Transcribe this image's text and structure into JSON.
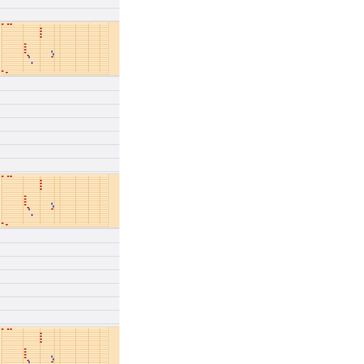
{
  "app": {
    "title": ""
  },
  "list": {
    "items": [
      {
        "type": "blank"
      },
      {
        "type": "thumbnail",
        "thumb": "spreadsheet-thumbnail"
      },
      {
        "type": "blank"
      },
      {
        "type": "blank"
      },
      {
        "type": "blank"
      },
      {
        "type": "blank"
      },
      {
        "type": "blank"
      },
      {
        "type": "blank"
      },
      {
        "type": "blank"
      },
      {
        "type": "thumbnail",
        "thumb": "spreadsheet-thumbnail"
      },
      {
        "type": "blank"
      },
      {
        "type": "blank"
      },
      {
        "type": "blank"
      },
      {
        "type": "blank"
      },
      {
        "type": "blank"
      },
      {
        "type": "blank"
      },
      {
        "type": "blank"
      },
      {
        "type": "thumbnail",
        "thumb": "spreadsheet-thumbnail"
      }
    ]
  },
  "colors": {
    "list_background": "#f1f1f4",
    "row_divider": "#d8d8dd",
    "thumbnail_fill": "#fde7c2",
    "thumbnail_accent_red": "#c23a2a",
    "thumbnail_accent_blue": "#4a57b8",
    "main_background": "#ffffff"
  }
}
